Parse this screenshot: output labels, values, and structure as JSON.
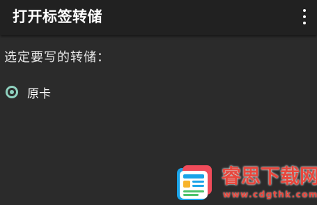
{
  "app_bar": {
    "title": "打开标签转储",
    "overflow_icon": "more-vert-icon",
    "background": "#212121"
  },
  "main": {
    "prompt": "选定要写的转储：",
    "options": [
      {
        "label": "原卡",
        "selected": true
      }
    ],
    "accent": "#8fd1bf",
    "background": "#2b2b2b"
  },
  "watermark": {
    "title": "睿思下载网",
    "url": "www.cdgthk.com",
    "color": "#e8473d"
  }
}
